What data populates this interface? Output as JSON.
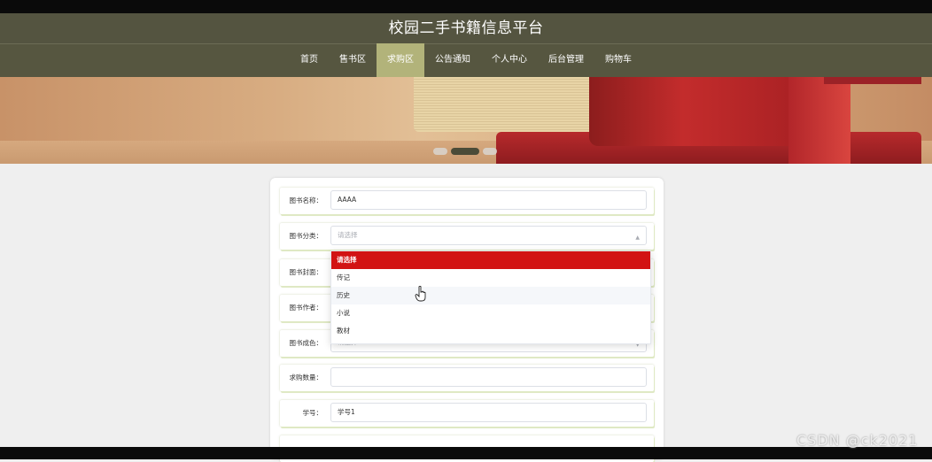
{
  "site": {
    "title": "校园二手书籍信息平台"
  },
  "nav": {
    "items": [
      "首页",
      "售书区",
      "求购区",
      "公告通知",
      "个人中心",
      "后台管理",
      "购物车"
    ],
    "active_index": 2
  },
  "form": {
    "rows": [
      {
        "label": "图书名称：",
        "value": "AAAA",
        "placeholder": ""
      },
      {
        "label": "图书分类：",
        "value": "",
        "placeholder": "请选择"
      },
      {
        "label": "图书封面：",
        "value": "",
        "placeholder": ""
      },
      {
        "label": "图书作者：",
        "value": "",
        "placeholder": ""
      },
      {
        "label": "图书成色：",
        "value": "",
        "placeholder": "请选择"
      },
      {
        "label": "求购数量：",
        "value": "",
        "placeholder": ""
      },
      {
        "label": "学号：",
        "value": "学号1",
        "placeholder": ""
      }
    ]
  },
  "dropdown": {
    "options": [
      "请选择",
      "传记",
      "历史",
      "小说",
      "教材"
    ],
    "selected_index": 0,
    "hover_index": 2
  },
  "colors": {
    "header": "#545440",
    "nav_active": "#b2b37a",
    "selected_option": "#d21313"
  },
  "watermark": "CSDN @ck2021"
}
